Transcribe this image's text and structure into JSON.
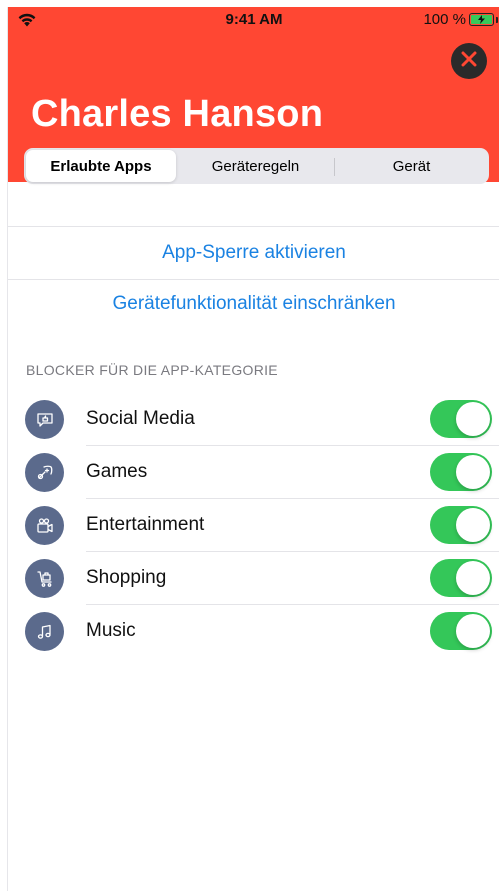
{
  "status_bar": {
    "time": "9:41 AM",
    "battery_percent": "100 %",
    "wifi_icon": "wifi-icon",
    "battery_icon": "battery-charging-icon"
  },
  "header": {
    "title": "Charles Hanson",
    "background_color": "#ff4733",
    "close_icon": "close-icon"
  },
  "tabs": [
    {
      "label": "Erlaubte Apps",
      "active": true
    },
    {
      "label": "Geräteregeln",
      "active": false
    },
    {
      "label": "Gerät",
      "active": false
    }
  ],
  "actions": {
    "app_lock": "App-Sperre aktivieren",
    "restrict_device": "Gerätefunktionalität einschränken",
    "link_color": "#1a82e2"
  },
  "categories": {
    "header": "BLOCKER FÜR DIE APP-KATEGORIE",
    "items": [
      {
        "label": "Social Media",
        "icon": "social-media-icon",
        "enabled": true
      },
      {
        "label": "Games",
        "icon": "gamepad-icon",
        "enabled": true
      },
      {
        "label": "Entertainment",
        "icon": "video-camera-icon",
        "enabled": true
      },
      {
        "label": "Shopping",
        "icon": "shopping-cart-icon",
        "enabled": true
      },
      {
        "label": "Music",
        "icon": "music-note-icon",
        "enabled": true
      }
    ],
    "toggle_on_color": "#34c759",
    "icon_bg_color": "#5b6a8c"
  }
}
